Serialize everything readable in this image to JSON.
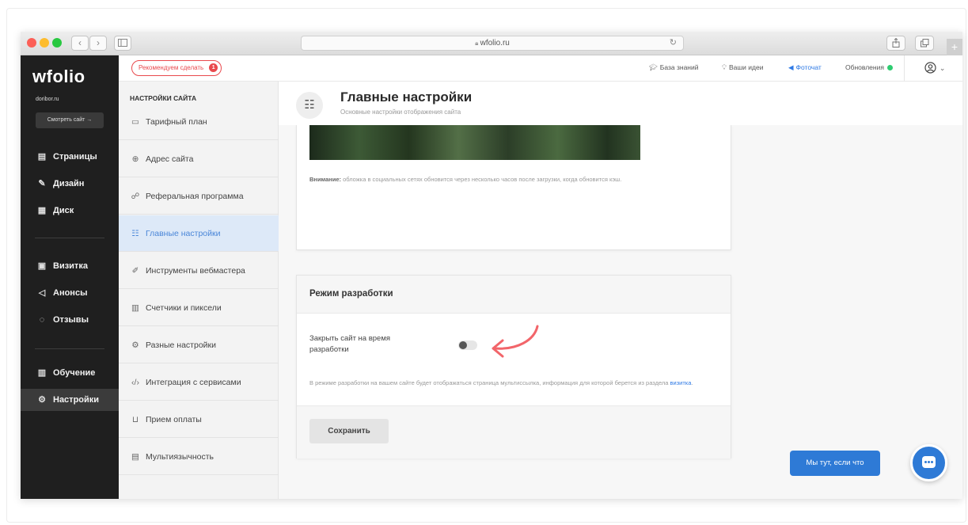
{
  "browser": {
    "url": "wfolio.ru",
    "nav_back": "‹",
    "nav_forward": "›",
    "reload": "↻",
    "plus": "+"
  },
  "sidebar": {
    "logo": "wfolio",
    "domain": "doribor.ru",
    "view_site": "Смотреть сайт →",
    "items": [
      {
        "label": "Страницы",
        "icon": "page-icon"
      },
      {
        "label": "Дизайн",
        "icon": "brush-icon"
      },
      {
        "label": "Диск",
        "icon": "disk-icon"
      },
      {
        "label": "Визитка",
        "icon": "card-icon"
      },
      {
        "label": "Анонсы",
        "icon": "megaphone-icon"
      },
      {
        "label": "Отзывы",
        "icon": "reviews-icon"
      },
      {
        "label": "Обучение",
        "icon": "book-icon"
      },
      {
        "label": "Настройки",
        "icon": "gear-icon"
      }
    ]
  },
  "topbar": {
    "recommend": "Рекомендуем сделать",
    "recommend_count": "1",
    "knowledge": "База знаний",
    "ideas": "Ваши идеи",
    "photochat": "Фоточат",
    "updates": "Обновления"
  },
  "settings": {
    "heading": "НАСТРОЙКИ САЙТА",
    "items": [
      {
        "label": "Тарифный план"
      },
      {
        "label": "Адрес сайта"
      },
      {
        "label": "Реферальная программа"
      },
      {
        "label": "Главные настройки"
      },
      {
        "label": "Инструменты вебмастера"
      },
      {
        "label": "Счетчики и пиксели"
      },
      {
        "label": "Разные настройки"
      },
      {
        "label": "Интеграция с сервисами"
      },
      {
        "label": "Прием оплаты"
      },
      {
        "label": "Мультиязычность"
      }
    ]
  },
  "main": {
    "title": "Главные настройки",
    "subtitle": "Основные настройки отображения сайта",
    "cover_note_bold": "Внимание:",
    "cover_note": "обложка в социальных сетях обновится через несколько часов после загрузки, когда обновится кэш.",
    "dev_title": "Режим разработки",
    "dev_label": "Закрыть сайт на время разработки",
    "dev_toggle_on": false,
    "dev_note": "В режиме разработки на вашем сайте будет отображаться страница мультиссылка, информация для которой берется из раздела",
    "dev_note_link": "визитка",
    "save": "Сохранить"
  },
  "chat": {
    "label": "Мы тут, если что"
  },
  "colors": {
    "accent": "#2e7ad6",
    "active_item_bg": "#dde9f8",
    "recommend_red": "#e9494d",
    "status_green": "#2ecc71"
  }
}
